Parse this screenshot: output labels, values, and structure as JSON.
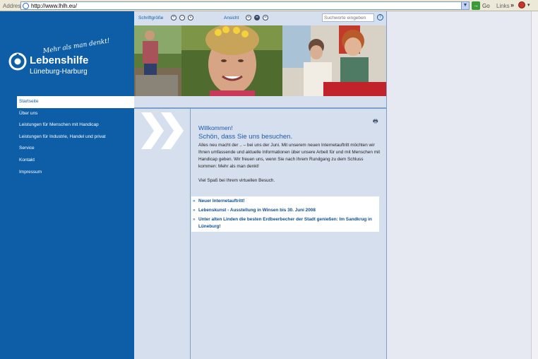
{
  "browser": {
    "address_label": "Address",
    "url": "http://www.lhlh.eu/",
    "go_label": "Go",
    "links_label": "Links"
  },
  "logo": {
    "tagline": "Mehr als man denkt!",
    "name": "Lebenshilfe",
    "region": "Lüneburg-Harburg"
  },
  "nav": {
    "items": [
      {
        "label": "Startseite",
        "active": true
      },
      {
        "label": "Über uns"
      },
      {
        "label": "Leistungen für Menschen mit Handicap"
      },
      {
        "label": "Leistungen für Industrie, Handel und privat"
      },
      {
        "label": "Service"
      },
      {
        "label": "Kontakt"
      },
      {
        "label": "Impressum"
      }
    ]
  },
  "toolbar": {
    "font_size_label": "Schriftgröße",
    "view_label": "Ansicht",
    "search_placeholder": "Suchworte eingeben",
    "help_symbol": "?"
  },
  "content": {
    "welcome": "Willkommen!",
    "subtitle": "Schön, dass Sie uns besuchen.",
    "paragraph1": "Alles neu macht der .. – bei uns der Juni. Mit unserem neuen Internetauftritt möchten wir Ihnen umfassende und aktuelle Informationen über unsere Arbeit für und mit Menschen mit Handicap geben. Wir freuen uns, wenn Sie nach Ihrem Rundgang zu dem Schluss kommen: Mehr als man denkt!",
    "paragraph2": "Viel Spaß bei Ihrem virtuellen Besuch."
  },
  "news": [
    "Neuer Internetauftritt!",
    "Lebenskunst - Ausstellung in Winsen bis 30. Juni 2008",
    "Unter alten Linden die besten Erdbeerbecher der Stadt genießen: Im Sandkrug in Lüneburg!"
  ],
  "colors": {
    "brand_blue": "#0d5ea7",
    "panel_bg": "#d6dfee",
    "news_link": "#0e4f8f"
  }
}
